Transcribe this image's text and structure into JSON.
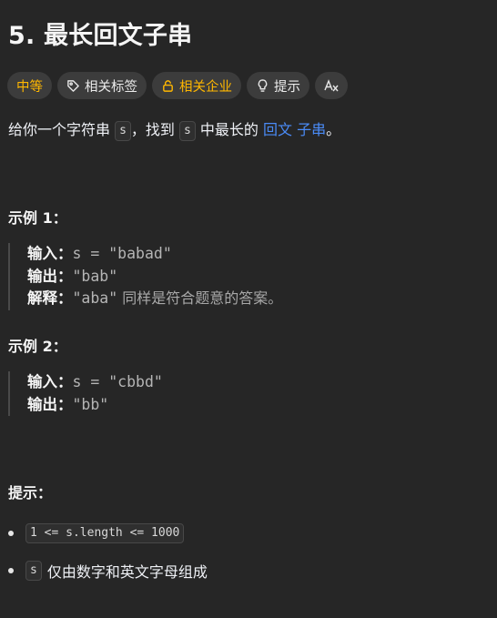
{
  "problem": {
    "title": "5. 最长回文子串"
  },
  "tags": {
    "difficulty": "中等",
    "related_topics": "相关标签",
    "related_companies": "相关企业",
    "hint": "提示",
    "translate_icon_label": "A"
  },
  "description": {
    "prefix": "给你一个字符串 ",
    "code_s": "s",
    "mid": "，找到 ",
    "code_s2": "s",
    "mid2": " 中最长的 ",
    "link1": "回文",
    "space": " ",
    "link2": "子串",
    "suffix": "。"
  },
  "examples": [
    {
      "heading": "示例 1：",
      "input_label": "输入：",
      "input_value": "s = \"babad\"",
      "output_label": "输出：",
      "output_value": "\"bab\"",
      "explain_label": "解释：",
      "explain_value": "\"aba\"",
      "explain_note": " 同样是符合题意的答案。"
    },
    {
      "heading": "示例 2：",
      "input_label": "输入：",
      "input_value": "s = \"cbbd\"",
      "output_label": "输出：",
      "output_value": "\"bb\""
    }
  ],
  "constraints": {
    "heading": "提示：",
    "items": [
      {
        "code": "1 <= s.length <= 1000",
        "text": ""
      },
      {
        "code": "s",
        "text": "仅由数字和英文字母组成"
      }
    ]
  },
  "colors": {
    "background": "#262626",
    "difficulty": "#ffb700",
    "link": "#4a8bf7"
  }
}
